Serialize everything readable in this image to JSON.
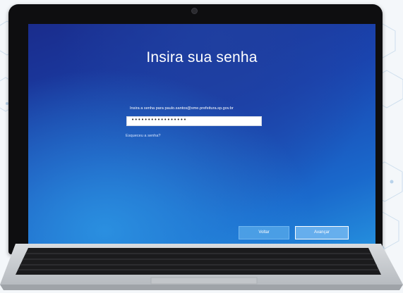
{
  "screen": {
    "title": "Insira sua senha",
    "prompt": "Insira a senha para paulo.santos@sme.prefeitura.sp.gov.br",
    "password": {
      "value": "•••••••••••••••••"
    },
    "forgot_link": "Esqueceu a senha?",
    "buttons": {
      "back": "Voltar",
      "next": "Avançar"
    }
  },
  "colors": {
    "screen_top": "#1a2c8c",
    "screen_bottom": "#2590de",
    "bezel": "#0e0e10",
    "chassis": "#c9ccd0"
  },
  "icons": [
    "camera-icon"
  ]
}
